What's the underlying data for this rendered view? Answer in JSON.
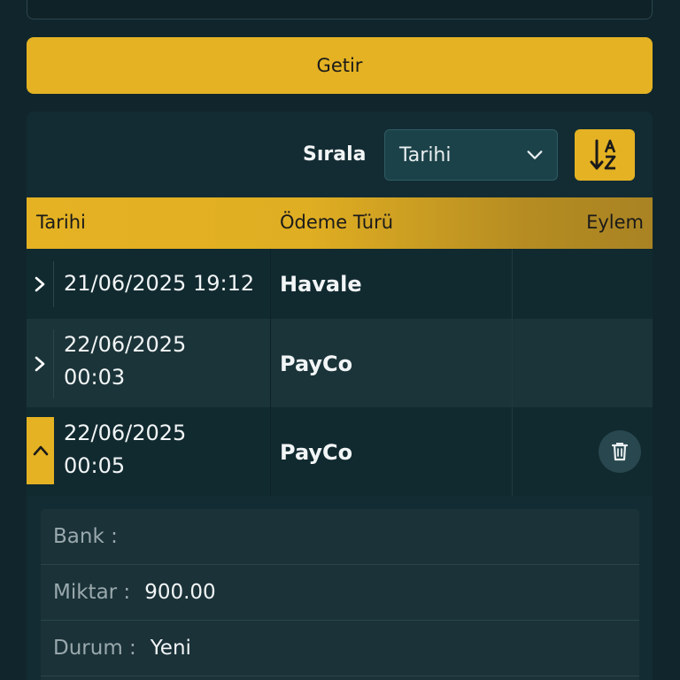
{
  "fetch_button": {
    "label": "Getir"
  },
  "sort": {
    "label": "Sırala",
    "selected": "Tarihi",
    "direction_icon": "sort-alpha-down-icon"
  },
  "table": {
    "headers": {
      "date": "Tarihi",
      "payment_type": "Ödeme Türü",
      "action": "Eylem"
    },
    "rows": [
      {
        "date_line1": "21/06/2025 19:12",
        "date_line2": "",
        "payment_type": "Havale",
        "expanded": false
      },
      {
        "date_line1": "22/06/2025",
        "date_line2": "00:03",
        "payment_type": "PayCo",
        "expanded": false
      },
      {
        "date_line1": "22/06/2025",
        "date_line2": "00:05",
        "payment_type": "PayCo",
        "expanded": true
      }
    ]
  },
  "details": {
    "bank_label": "Bank :",
    "bank_value": "",
    "amount_label": "Miktar :",
    "amount_value": "900.00",
    "status_label": "Durum :",
    "status_value": "Yeni"
  },
  "colors": {
    "accent": "#e4b223",
    "background": "#10262c",
    "panel": "#132c33"
  }
}
